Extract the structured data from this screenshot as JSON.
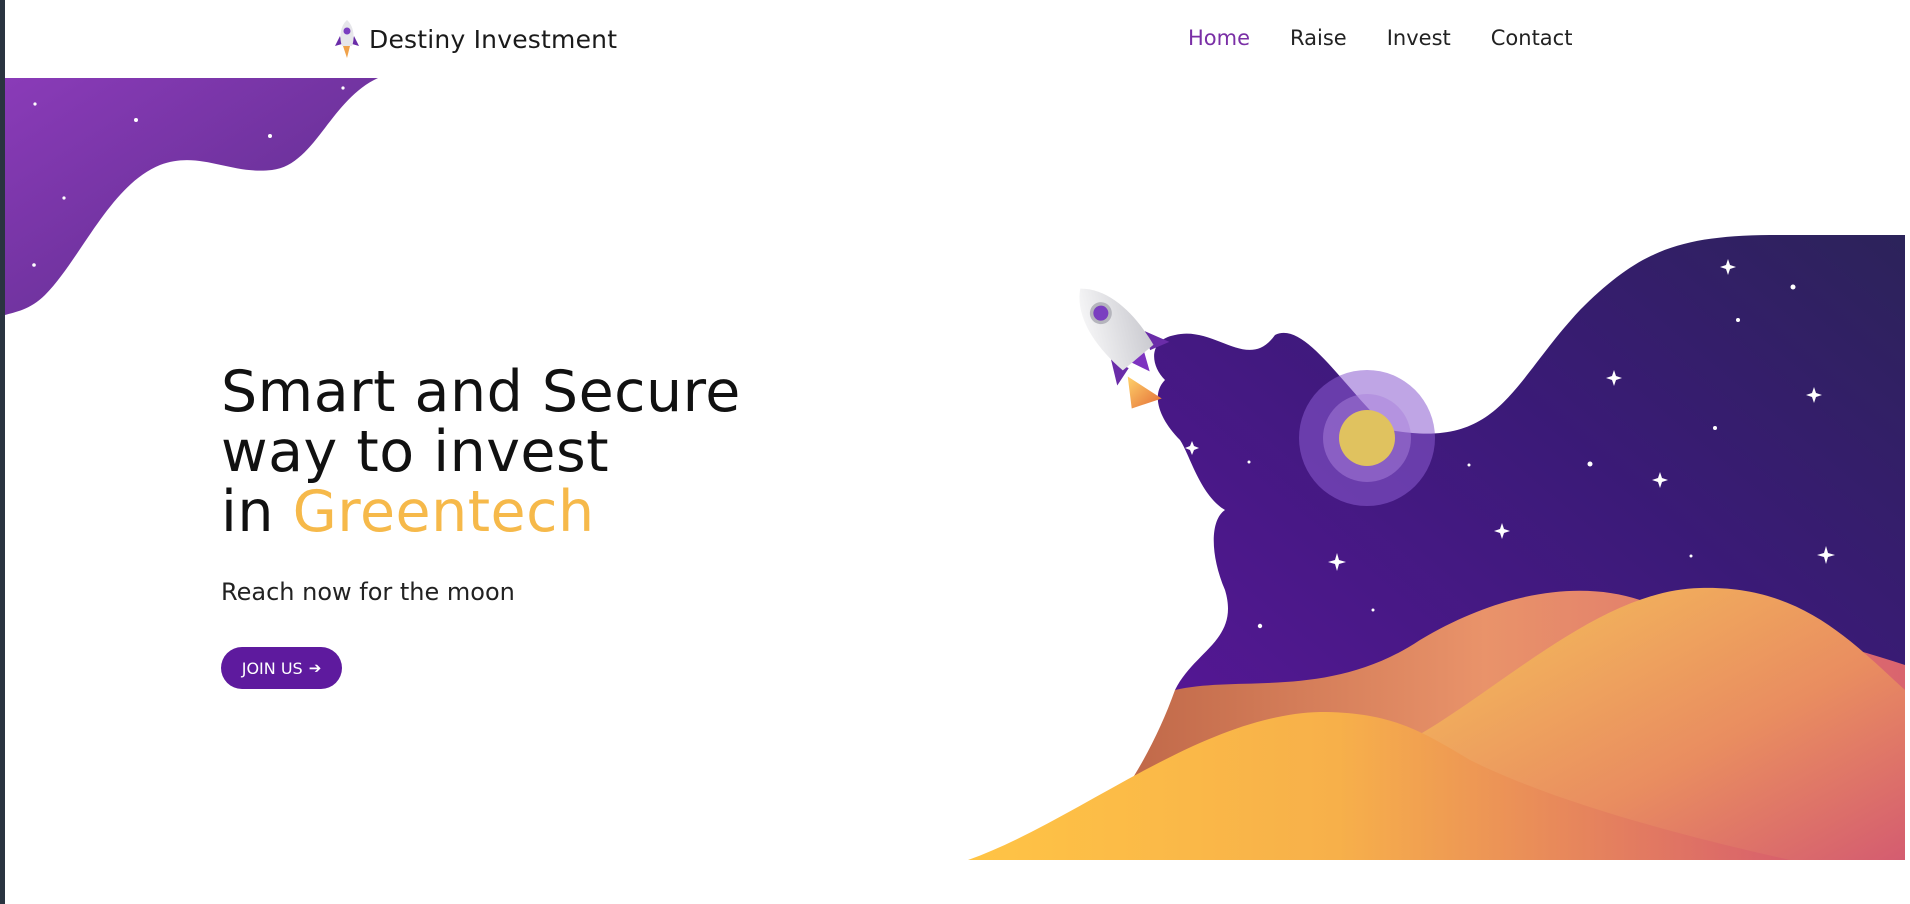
{
  "brand": {
    "name": "Destiny Investment"
  },
  "nav": {
    "items": [
      {
        "label": "Home",
        "active": true
      },
      {
        "label": "Raise",
        "active": false
      },
      {
        "label": "Invest",
        "active": false
      },
      {
        "label": "Contact",
        "active": false
      }
    ]
  },
  "hero": {
    "title_line1": "Smart and Secure",
    "title_line2": "way to invest",
    "title_line3_prefix": "in ",
    "title_line3_accent": "Greentech",
    "subtitle": "Reach now for the moon",
    "cta_label": "JOIN US",
    "cta_icon": "arrow-right-icon"
  },
  "colors": {
    "accent_purple": "#7a2fa6",
    "button_purple": "#5e1a9e",
    "highlight_yellow": "#f6b94a"
  }
}
